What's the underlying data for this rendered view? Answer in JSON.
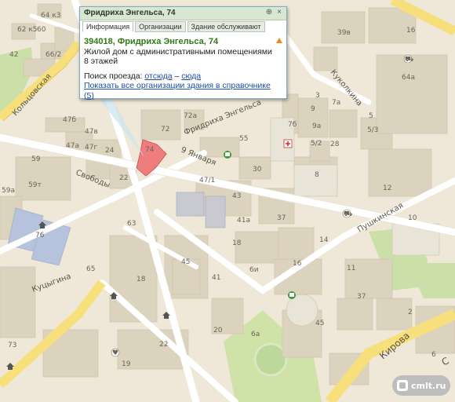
{
  "balloon": {
    "title": "Фридриха Энгельса, 74",
    "tabs": [
      "Информация",
      "Организации",
      "Здание обслуживают"
    ],
    "address": "394018, Фридриха Энгельса, 74",
    "description": "Жилой дом с административными помещениями",
    "floors": "8 этажей",
    "route_label": "Поиск проезда:",
    "route_from": "отсюда",
    "route_dash": "–",
    "route_to": "сюда",
    "show_orgs": "Показать все организации здания в справочнике (5)",
    "pin_icon": "pin-icon",
    "close_icon": "close-icon"
  },
  "streets": {
    "engelsa": "Фридриха Энгельса",
    "yanvarya": "9 Января",
    "svobody": "Свободы",
    "koltsovskaya": "Кольцовская",
    "kukolkina": "Куколкина",
    "pushkinskaya": "Пушкинская",
    "kirova": "Кирова",
    "kutsygina": "Куцыгина",
    "partial": "С"
  },
  "houses": [
    "64 к3",
    "62 к5",
    "60",
    "42",
    "66/2",
    "47б",
    "47в",
    "47а",
    "47г",
    "59",
    "24",
    "22",
    "59а",
    "59т",
    "76",
    "63",
    "65",
    "18",
    "45",
    "41",
    "22",
    "20",
    "73",
    "19",
    "74",
    "72",
    "72а",
    "55",
    "30",
    "47/1",
    "43",
    "41а",
    "37",
    "14",
    "18",
    "16",
    "37",
    "6и",
    "6а",
    "45",
    "7б",
    "9",
    "9а",
    "7а",
    "3",
    "5",
    "5/2",
    "5/3",
    "28",
    "8",
    "64а",
    "39в",
    "16",
    "12",
    "10",
    "2",
    "11",
    "6"
  ],
  "watermark": "cmlt.ru",
  "icons": [
    "pin-icon",
    "close-icon",
    "warning-icon",
    "shopping-cart-icon",
    "house-icon",
    "bus-stop-icon",
    "medical-cross-icon",
    "clothes-icon",
    "watermark-logo-icon"
  ]
}
